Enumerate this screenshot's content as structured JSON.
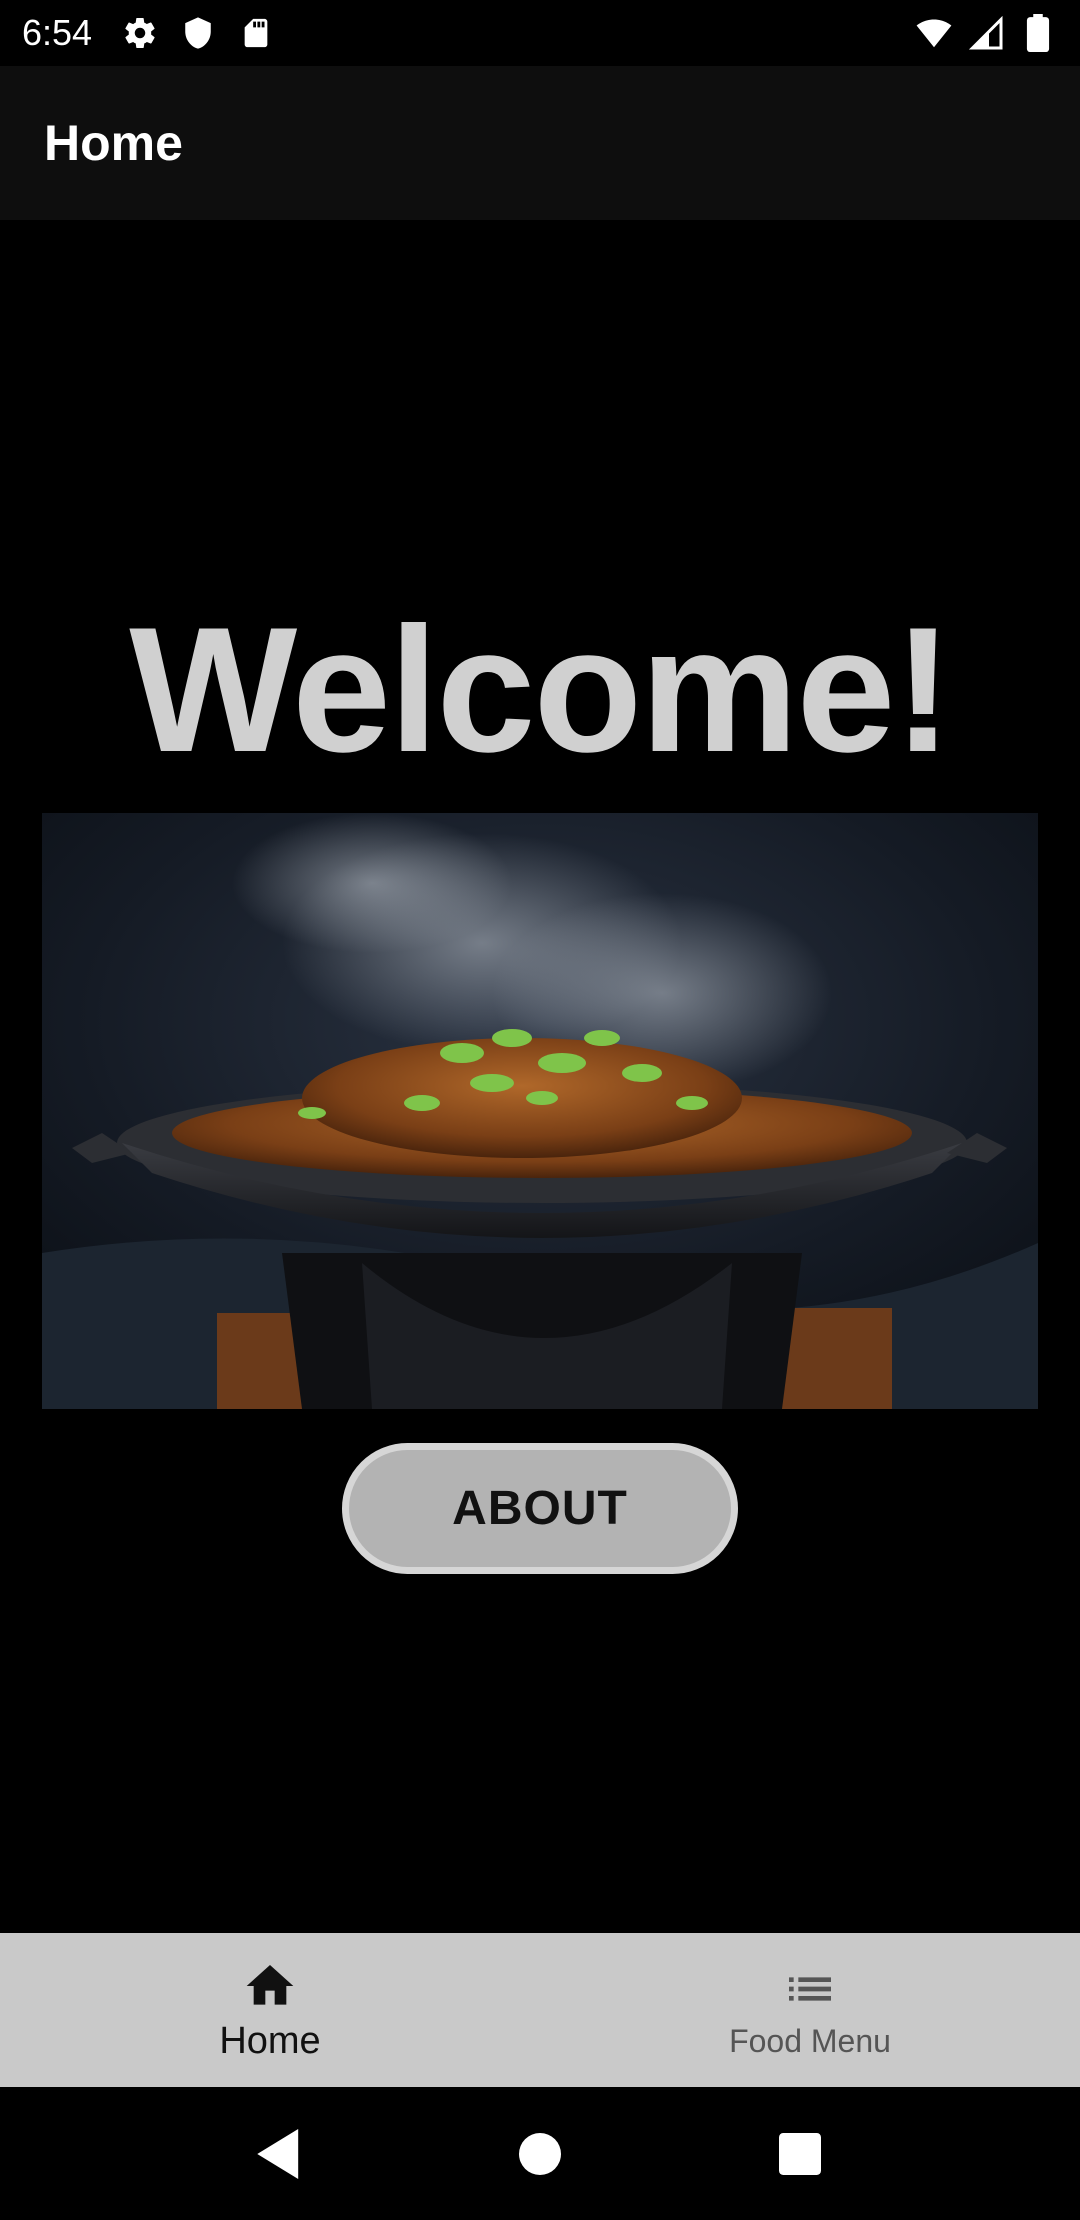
{
  "status_bar": {
    "time": "6:54",
    "left_icons": [
      "settings-icon",
      "shield-icon",
      "sd-card-icon"
    ],
    "right_icons": [
      "wifi-icon",
      "signal-icon",
      "battery-icon"
    ]
  },
  "app_bar": {
    "title": "Home"
  },
  "main": {
    "welcome_text": "Welcome!",
    "hero_image": "food-dish-photo",
    "about_button_label": "ABOUT"
  },
  "bottom_nav": {
    "items": [
      {
        "label": "Home",
        "icon": "home-icon",
        "active": true
      },
      {
        "label": "Food Menu",
        "icon": "list-icon",
        "active": false
      }
    ]
  },
  "system_nav": [
    "back-icon",
    "home-circle-icon",
    "recents-icon"
  ],
  "colors": {
    "background": "#000000",
    "app_bar": "#0e0e0e",
    "welcome_text": "#d0d0d0",
    "button": "#b3b3b3",
    "bottom_nav": "#c9c9c9"
  }
}
